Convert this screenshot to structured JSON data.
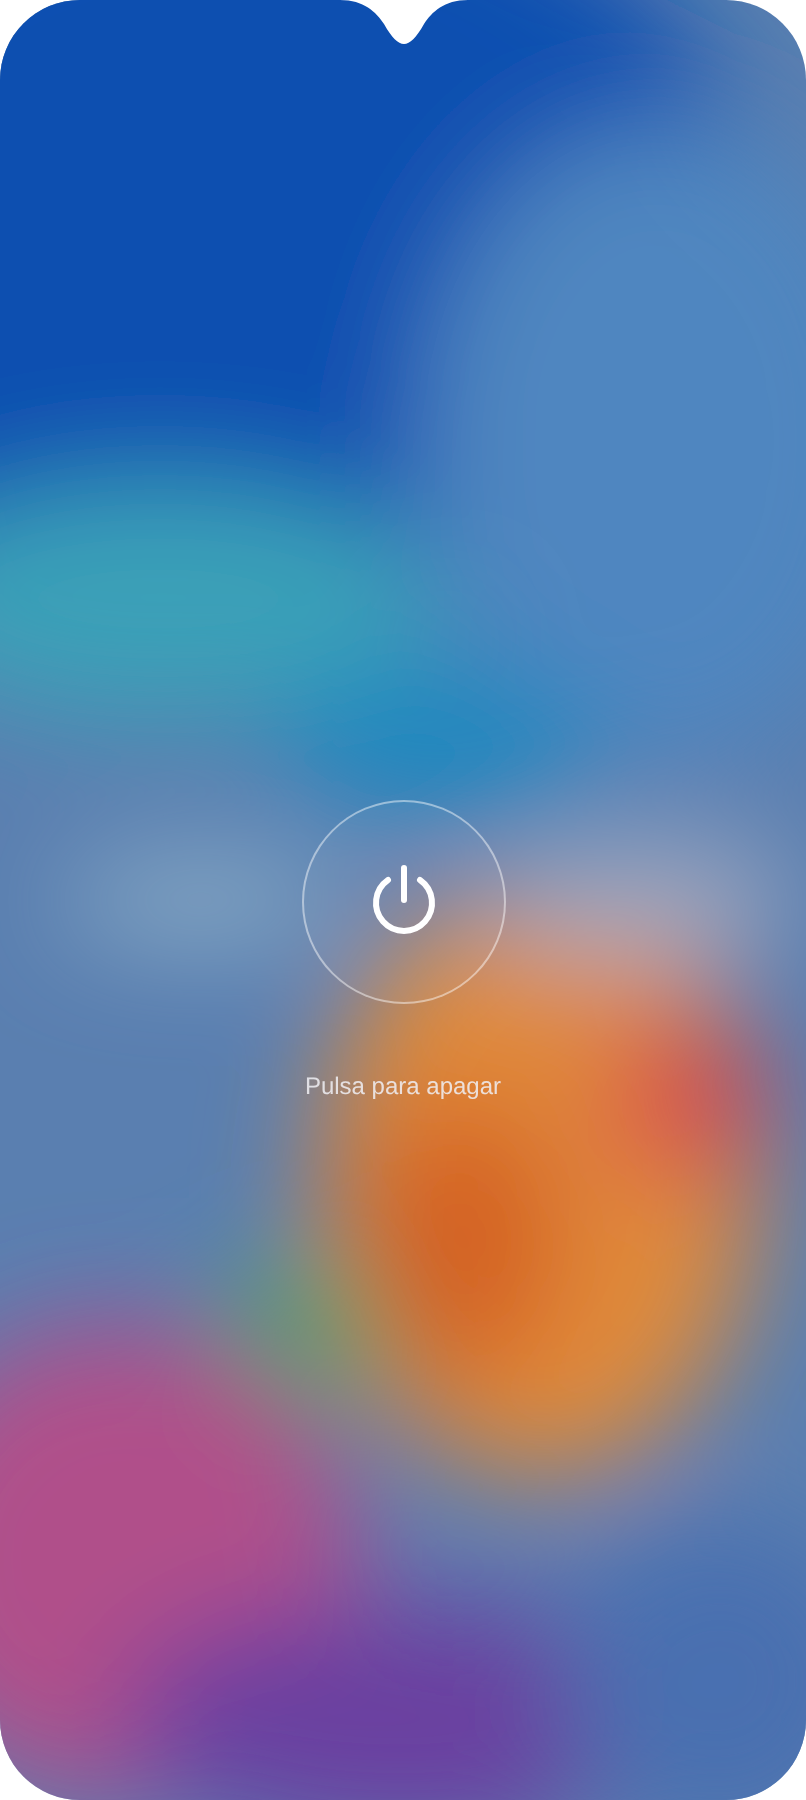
{
  "power_button": {
    "label": "Pulsa para apagar"
  }
}
